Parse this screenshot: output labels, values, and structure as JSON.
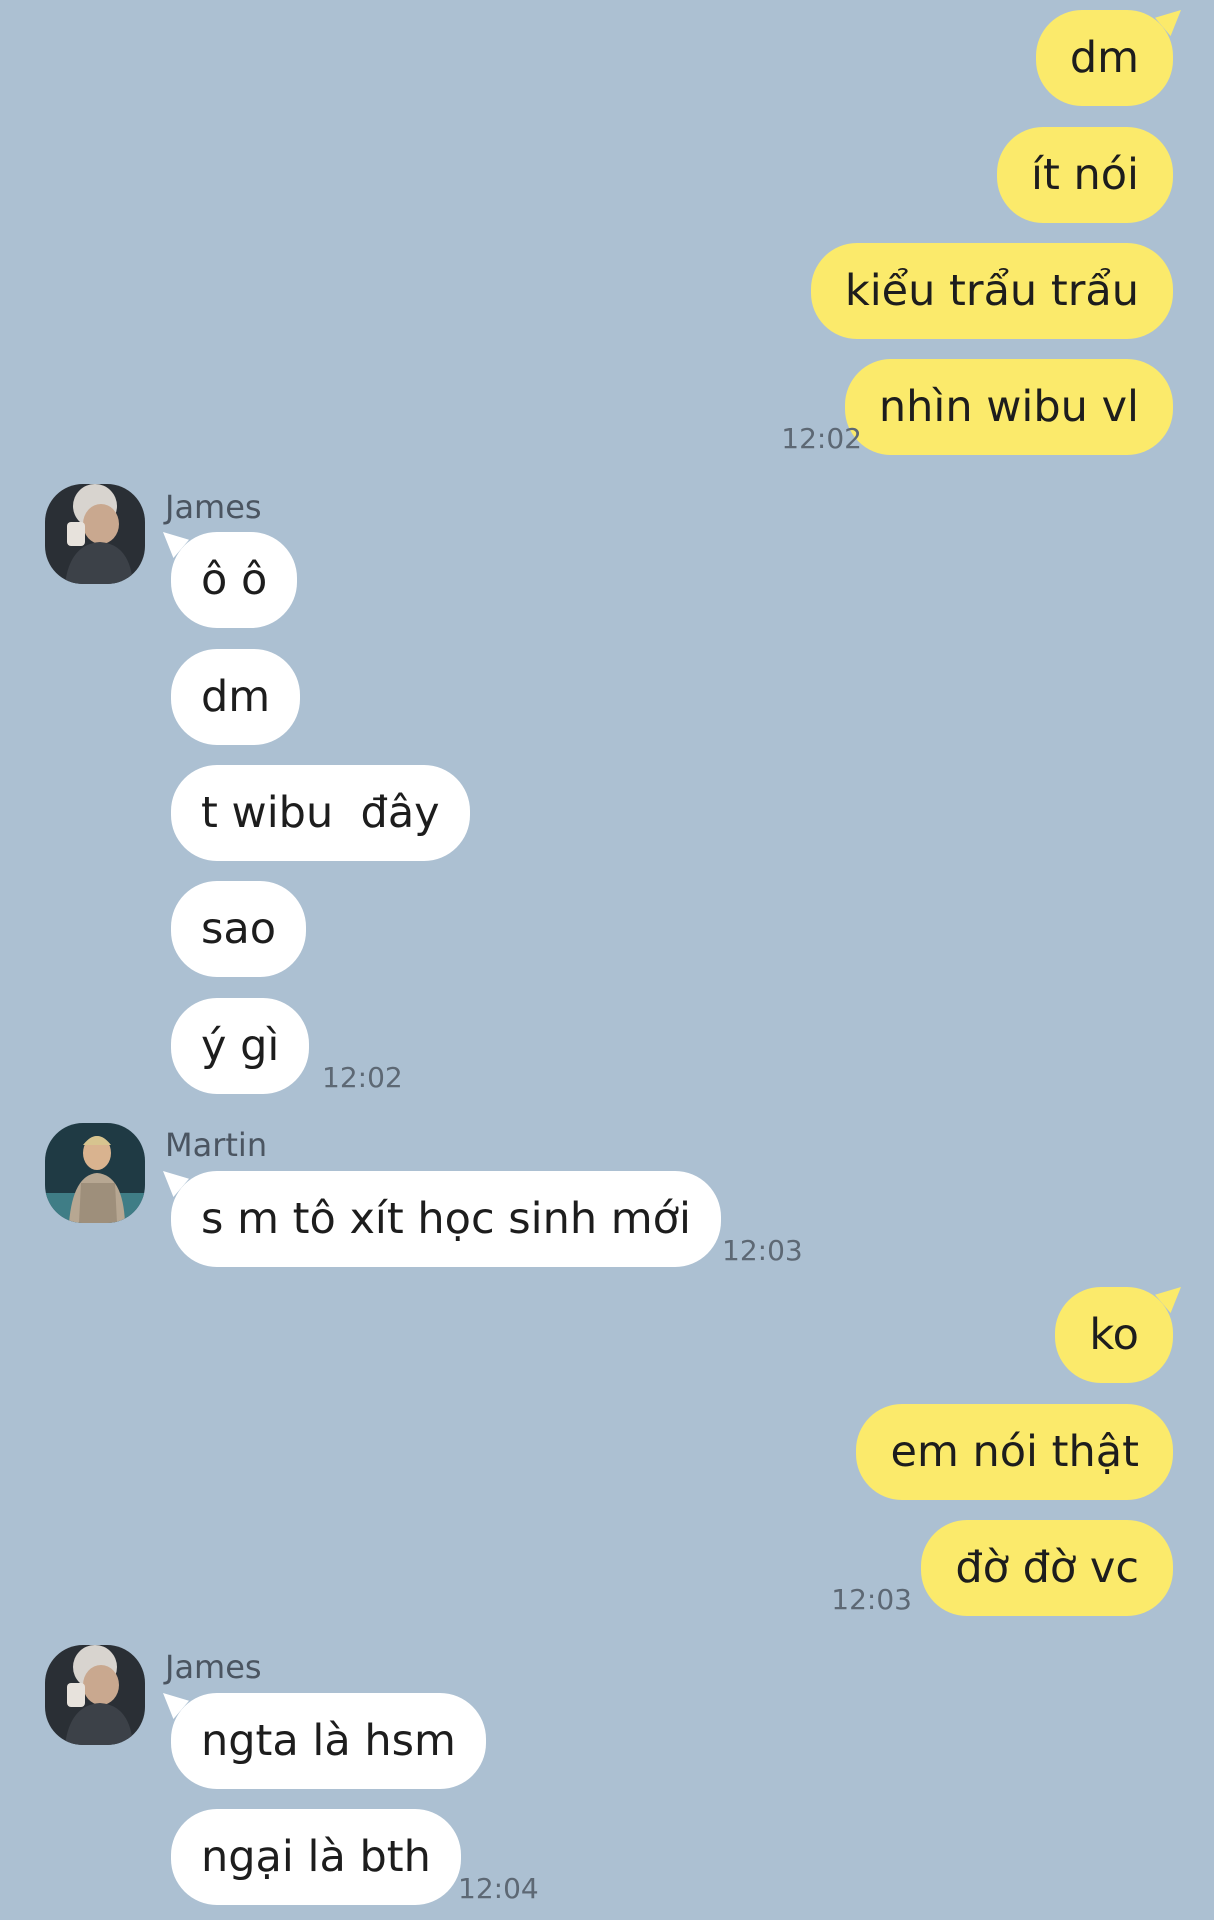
{
  "messages": {
    "out1": "dm",
    "out2": "ít nói",
    "out3": "kiểu trẩu trẩu",
    "out4": "nhìn wibu vl",
    "in1": "ô ô",
    "in2": "dm",
    "in3": "t wibu  đây",
    "in4": "sao",
    "in5": "ý gì",
    "in6": "s m tô xít học sinh mới",
    "out5": "ko",
    "out6": "em nói thật",
    "out7": "đờ đờ vc",
    "in7": "ngta là hsm",
    "in8": "ngại là bth"
  },
  "senders": {
    "first": "James",
    "second": "Martin",
    "third": "James"
  },
  "times": {
    "t1": "12:02",
    "t2": "12:02",
    "t3": "12:03",
    "t4": "12:03",
    "t5": "12:04"
  },
  "icons": {
    "avatar_james": "user-avatar-icon",
    "avatar_martin": "user-avatar-icon"
  },
  "colors": {
    "background": "#acc0d2",
    "outgoing_bubble": "#fbea6b",
    "incoming_bubble": "#ffffff"
  }
}
